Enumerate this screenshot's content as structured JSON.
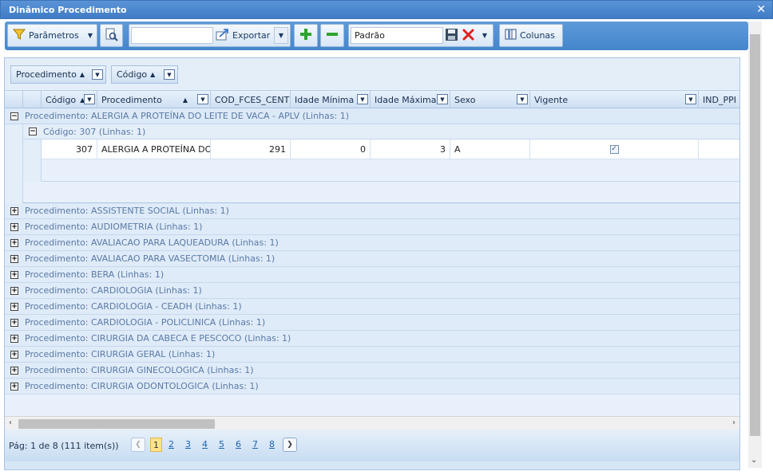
{
  "window": {
    "title": "Dinâmico Procedimento",
    "close_symbol": "✕"
  },
  "toolbar": {
    "params_label": "Parâmetros",
    "export_label": "Exportar",
    "layout_value": "Padrão",
    "columns_label": "Colunas"
  },
  "group_panel": {
    "chips": [
      {
        "label": "Procedimento"
      },
      {
        "label": "Código"
      }
    ]
  },
  "columns": [
    {
      "label": "Código"
    },
    {
      "label": "Procedimento"
    },
    {
      "label": "COD_FCES_CENTRO"
    },
    {
      "label": "Idade Mínima"
    },
    {
      "label": "Idade Máxima"
    },
    {
      "label": "Sexo"
    },
    {
      "label": "Vigente"
    },
    {
      "label": "IND_PPI"
    }
  ],
  "expanded_group": {
    "label": "Procedimento: ALERGIA A PROTEÍNA DO LEITE DE VACA - APLV (Linhas: 1)",
    "subgroup_label": "Código: 307 (Linhas: 1)",
    "row": {
      "codigo": "307",
      "procedimento": "ALERGIA A PROTEÍNA DO LEITE DE VACA - APLV",
      "cod_fces": "291",
      "idade_min": "0",
      "idade_max": "3",
      "sexo": "A",
      "vigente": true
    }
  },
  "collapsed_groups": [
    "Procedimento: ASSISTENTE SOCIAL (Linhas: 1)",
    "Procedimento: AUDIOMETRIA (Linhas: 1)",
    "Procedimento: AVALIACAO PARA LAQUEADURA (Linhas: 1)",
    "Procedimento: AVALIACAO PARA VASECTOMIA (Linhas: 1)",
    "Procedimento: BERA (Linhas: 1)",
    "Procedimento: CARDIOLOGIA (Linhas: 1)",
    "Procedimento: CARDIOLOGIA - CEADH (Linhas: 1)",
    "Procedimento: CARDIOLOGIA - POLICLINICA (Linhas: 1)",
    "Procedimento: CIRURGIA DA CABECA E PESCOCO (Linhas: 1)",
    "Procedimento: CIRURGIA GERAL (Linhas: 1)",
    "Procedimento: CIRURGIA GINECOLOGICA (Linhas: 1)",
    "Procedimento: CIRURGIA ODONTOLOGICA (Linhas: 1)"
  ],
  "pager": {
    "info": "Pág: 1 de 8 (111 item(s))",
    "pages": [
      "1",
      "2",
      "3",
      "4",
      "5",
      "6",
      "7",
      "8"
    ],
    "current": "1"
  },
  "icons": {
    "filter": "filter-icon",
    "preview": "print-preview-icon",
    "export": "export-icon",
    "add": "plus-icon",
    "remove": "minus-icon",
    "save": "save-icon",
    "delete": "delete-icon",
    "columns": "columns-icon"
  },
  "colors": {
    "titlebar": "#3f7cc6",
    "toolbar": "#4485cc",
    "group_text": "#5a7aa6",
    "pager_active": "#fde38a"
  }
}
